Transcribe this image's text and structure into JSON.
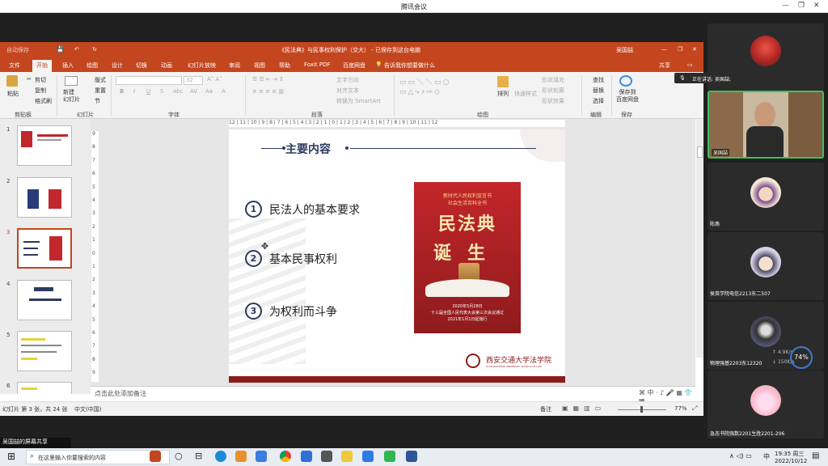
{
  "meeting": {
    "title": "腾讯会议",
    "sharing_label": "吴国喆的屏幕共享",
    "speaking_label": "正在讲话: 吴国喆;"
  },
  "ppt": {
    "autosave": "自动保存",
    "doc_title": "《民法典》与民事权利保护（交大） - 已保存到这台电脑",
    "user": "吴国喆",
    "share": "共享",
    "tabs": [
      "文件",
      "开始",
      "插入",
      "绘图",
      "设计",
      "切换",
      "动画",
      "幻灯片放映",
      "审阅",
      "视图",
      "帮助",
      "Foxit PDF",
      "百度网盘"
    ],
    "tell_me": "告诉我你想要做什么",
    "ribbon": {
      "paste": "粘贴",
      "cut": "剪切",
      "copy": "复制",
      "format_painter": "格式刷",
      "new_slide": "新建\n幻灯片",
      "layout": "版式",
      "reset": "重置",
      "section": "节",
      "font_size": "32",
      "text_direction": "文字方向",
      "align_text": "对齐文本",
      "convert_smartart": "转换为 SmartArt",
      "arrange": "排列",
      "quick_styles": "快速样式",
      "shape_fill": "形状填充",
      "shape_outline": "形状轮廓",
      "shape_effects": "形状效果",
      "find": "查找",
      "replace": "替换",
      "select": "选择",
      "save_baidu": "保存到\n百度网盘",
      "groups": [
        "剪贴板",
        "幻灯片",
        "字体",
        "段落",
        "绘图",
        "编辑",
        "保存"
      ]
    },
    "ruler_text": "12 | 11 | 10 | 9 | 8 | 7 | 6 | 5 | 4 | 3 | 2 | 1 | 0 | 1 | 2 | 3 | 4 | 5 | 6 | 7 | 8 | 9 | 10 | 11 | 12",
    "vruler": [
      "9",
      "8",
      "7",
      "6",
      "5",
      "4",
      "3",
      "2",
      "1",
      "0",
      "1",
      "2",
      "3",
      "4",
      "5",
      "6",
      "7",
      "8",
      "9"
    ],
    "slide": {
      "heading": "主要内容",
      "items": [
        {
          "num": "1",
          "text": "民法人的基本要求"
        },
        {
          "num": "2",
          "text": "基本民事权利"
        },
        {
          "num": "3",
          "text": "为权利而斗争"
        }
      ],
      "book": {
        "line1": "新时代人民权利宣言书",
        "line2": "社会生活百科全书",
        "title": "民法典",
        "subtitle": "诞生",
        "date": "2020年5月28日",
        "passed": "十三届全国人民代表大会第三次会议通过",
        "effective": "2021年1月1日起施行"
      },
      "school_cn": "西安交通大学法学院",
      "school_en": "XI'AN JIAOTONG UNIVERSITY SCHOOL OF LAW"
    },
    "thumb_numbers": [
      "1",
      "2",
      "3",
      "4",
      "5",
      "6"
    ],
    "notes_placeholder": "点击此处添加备注",
    "status": {
      "slide_info": "幻灯片 第 3 张，共 24 张",
      "lang": "中文(中国)",
      "notes": "备注",
      "zoom": "77%"
    }
  },
  "participants": [
    {
      "name": ""
    },
    {
      "name": "吴国喆"
    },
    {
      "name": "陈燕"
    },
    {
      "name": "侯英学院电信2213东二507"
    },
    {
      "name": "物理强基2203东12320"
    },
    {
      "name": "急态书院强数2201生胜2201-206"
    }
  ],
  "network": {
    "up": "4.9",
    "down": "150",
    "up_unit": "K/s",
    "down_unit": "K/s",
    "percent": "74%"
  },
  "taskbar": {
    "search_placeholder": "在这里输入你要搜索的内容",
    "time": "19:35 周三",
    "date": "2022/10/12",
    "ime": "中"
  }
}
